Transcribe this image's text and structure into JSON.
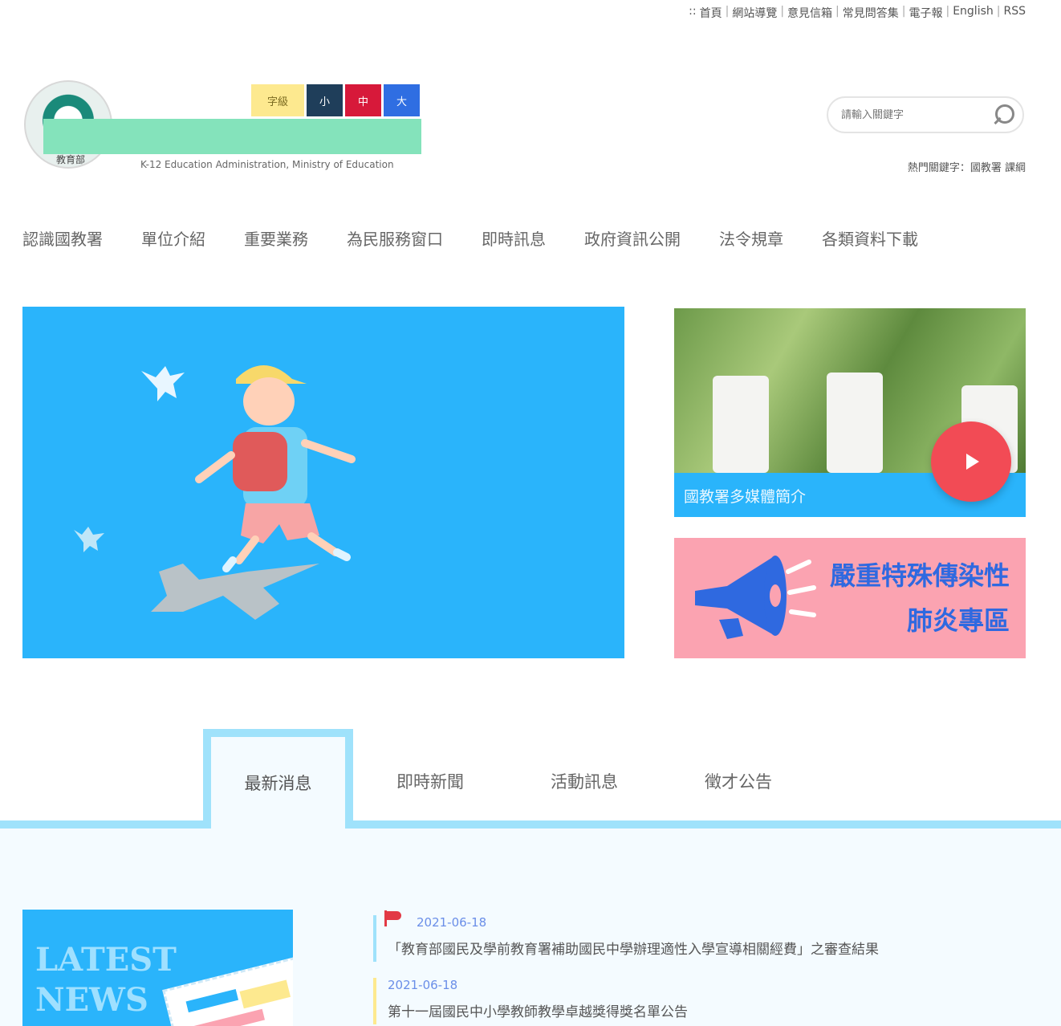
{
  "utility_links": [
    "::",
    "首頁",
    "網站導覽",
    "意見信箱",
    "常見問答集",
    "電子報",
    "English",
    "RSS"
  ],
  "header": {
    "logo_caption": "教育部",
    "org_name_en": "K-12 Education Administration, Ministry of Education",
    "font_size": {
      "label": "字級",
      "small": "小",
      "medium": "中",
      "large": "大"
    },
    "search_placeholder": "請輸入關鍵字",
    "hot_keywords": "熱門關鍵字：國教署 課綱"
  },
  "nav": [
    "認識國教署",
    "單位介紹",
    "重要業務",
    "為民服務窗口",
    "即時訊息",
    "政府資訊公開",
    "法令規章",
    "各類資料下載"
  ],
  "video": {
    "caption": "國教署多媒體簡介"
  },
  "epidemic": {
    "line1": "嚴重特殊傳染性",
    "line2": "肺炎專區"
  },
  "tabs": {
    "active": "最新消息",
    "others": [
      "即時新聞",
      "活動訊息",
      "徵才公告"
    ]
  },
  "news_box": {
    "title_line1": "LATEST",
    "title_line2": "NEWS"
  },
  "news": [
    {
      "date": "2021-06-18",
      "title": "「教育部國民及學前教育署補助國民中學辦理適性入學宣導相關經費」之審查結果",
      "pinned": true,
      "bar_color": "#9fe2fb"
    },
    {
      "date": "2021-06-18",
      "title": "第十一屆國民中小學教師教學卓越獎得獎名單公告",
      "pinned": false,
      "bar_color": "#fde98f"
    }
  ],
  "colors": {
    "primary": "#2ab4fb",
    "tab_border": "#9fe2fb",
    "pink": "#fba3b1",
    "red": "#f24b55",
    "blue_text": "#2f69e0"
  }
}
